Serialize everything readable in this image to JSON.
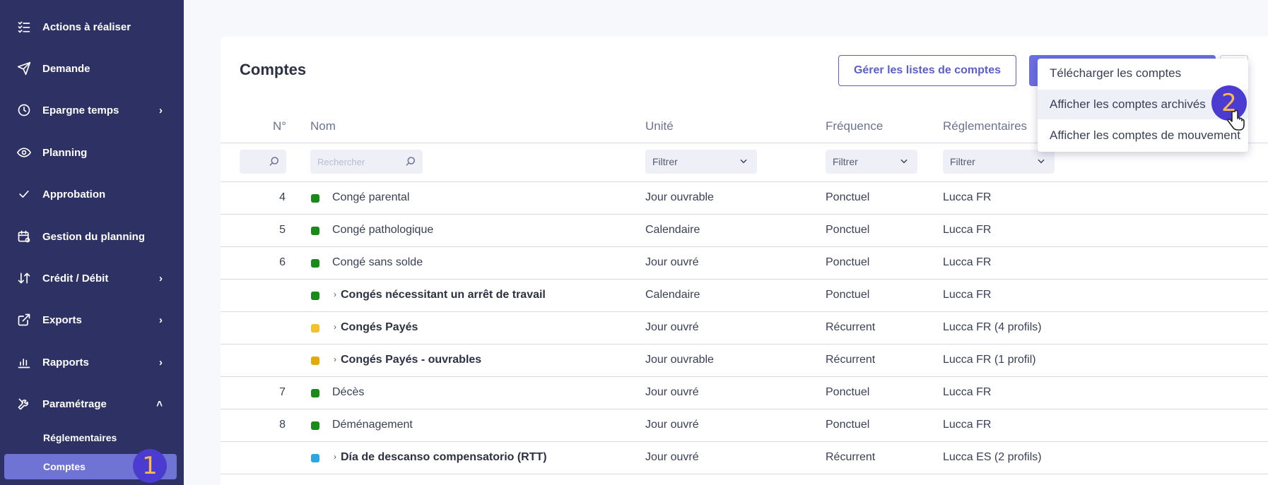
{
  "sidebar": {
    "items": [
      {
        "label": "Actions à réaliser",
        "icon": "checklist-icon",
        "chevron": ""
      },
      {
        "label": "Demande",
        "icon": "send-icon",
        "chevron": ""
      },
      {
        "label": "Epargne temps",
        "icon": "clock-icon",
        "chevron": "›"
      },
      {
        "label": "Planning",
        "icon": "eye-icon",
        "chevron": ""
      },
      {
        "label": "Approbation",
        "icon": "check-icon",
        "chevron": ""
      },
      {
        "label": "Gestion du planning",
        "icon": "calendar-gear-icon",
        "chevron": ""
      },
      {
        "label": "Crédit / Débit",
        "icon": "arrows-updown-icon",
        "chevron": "›"
      },
      {
        "label": "Exports",
        "icon": "external-link-icon",
        "chevron": "›"
      },
      {
        "label": "Rapports",
        "icon": "bar-chart-icon",
        "chevron": "›"
      },
      {
        "label": "Paramétrage",
        "icon": "tools-icon",
        "chevron": "˄"
      }
    ],
    "sub_items": [
      {
        "label": "Réglementaires",
        "active": false
      },
      {
        "label": "Comptes",
        "active": true
      }
    ],
    "step_badge": "1"
  },
  "main": {
    "title": "Comptes",
    "manage_button": "Gérer les listes de comptes",
    "table": {
      "headers": {
        "num": "N°",
        "name": "Nom",
        "unit": "Unité",
        "frequency": "Fréquence",
        "regulation": "Réglementaires"
      },
      "search_placeholder": "Rechercher",
      "filter_placeholder": "Filtrer",
      "rows": [
        {
          "num": "4",
          "color": "#1a8a1a",
          "name": "Congé parental",
          "group": false,
          "unit": "Jour ouvrable",
          "frequency": "Ponctuel",
          "regulation": "Lucca FR"
        },
        {
          "num": "5",
          "color": "#1a8a1a",
          "name": "Congé pathologique",
          "group": false,
          "unit": "Calendaire",
          "frequency": "Ponctuel",
          "regulation": "Lucca FR"
        },
        {
          "num": "6",
          "color": "#1a8a1a",
          "name": "Congé sans solde",
          "group": false,
          "unit": "Jour ouvré",
          "frequency": "Ponctuel",
          "regulation": "Lucca FR"
        },
        {
          "num": "",
          "color": "#1a8a1a",
          "name": "Congés nécessitant un arrêt de travail",
          "group": true,
          "unit": "Calendaire",
          "frequency": "Ponctuel",
          "regulation": "Lucca FR"
        },
        {
          "num": "",
          "color": "#f2c12e",
          "name": "Congés Payés",
          "group": true,
          "unit": "Jour ouvré",
          "frequency": "Récurrent",
          "regulation": "Lucca FR (4 profils)"
        },
        {
          "num": "",
          "color": "#e3a90a",
          "name": "Congés Payés - ouvrables",
          "group": true,
          "unit": "Jour ouvrable",
          "frequency": "Récurrent",
          "regulation": "Lucca FR (1 profil)"
        },
        {
          "num": "7",
          "color": "#1a8a1a",
          "name": "Décès",
          "group": false,
          "unit": "Jour ouvré",
          "frequency": "Ponctuel",
          "regulation": "Lucca FR"
        },
        {
          "num": "8",
          "color": "#1a8a1a",
          "name": "Déménagement",
          "group": false,
          "unit": "Jour ouvré",
          "frequency": "Ponctuel",
          "regulation": "Lucca FR"
        },
        {
          "num": "",
          "color": "#2aa6e0",
          "name": "Día de descanso compensatorio (RTT)",
          "group": true,
          "unit": "Jour ouvré",
          "frequency": "Récurrent",
          "regulation": "Lucca ES (2 profils)"
        }
      ]
    },
    "menu": {
      "items": [
        {
          "label": "Télécharger les comptes"
        },
        {
          "label": "Afficher les comptes archivés"
        },
        {
          "label": "Afficher les comptes de mouvement"
        }
      ],
      "step_badge": "2"
    }
  },
  "colors": {
    "sidebar_bg": "#2d3164",
    "accent": "#5b5fc7",
    "active_item": "#6f73d4"
  }
}
